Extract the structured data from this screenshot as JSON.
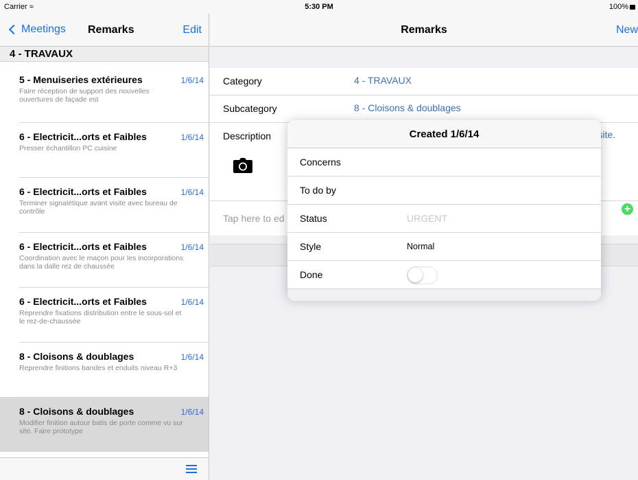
{
  "status_bar": {
    "carrier": "Carrier",
    "time": "5:30 PM",
    "battery": "100%"
  },
  "master": {
    "back_label": "Meetings",
    "title": "Remarks",
    "edit_label": "Edit",
    "section_header": "4 - TRAVAUX",
    "items": [
      {
        "title": "5 - Menuiseries extérieures",
        "date": "1/6/14",
        "desc": "Faire réception de support des nouvelles ouvertures de façade est"
      },
      {
        "title": "6 - Electricit...orts et Faibles",
        "date": "1/6/14",
        "desc": "Presser échantillon PC cuisine"
      },
      {
        "title": "6 - Electricit...orts et Faibles",
        "date": "1/6/14",
        "desc": "Terminer signalétique avant visite avec bureau de contrôle"
      },
      {
        "title": "6 - Electricit...orts et Faibles",
        "date": "1/6/14",
        "desc": "Coordination avec le maçon pour les incorporations dans la dalle  rez de chaussée"
      },
      {
        "title": "6 - Electricit...orts et Faibles",
        "date": "1/6/14",
        "desc": "Reprendre fixations  distribution entre le sous-sol et le rez-de-chaussée"
      },
      {
        "title": "8 - Cloisons & doublages",
        "date": "1/6/14",
        "desc": "Reprendre finitions bandes et enduits niveau R+3"
      },
      {
        "title": "8 - Cloisons & doublages",
        "date": "1/6/14",
        "desc": "Modifier finition autour batis de porte comme vu sur site. Faire prototype"
      }
    ]
  },
  "detail": {
    "title": "Remarks",
    "new_label": "New",
    "category_label": "Category",
    "category_value": "4 - TRAVAUX",
    "subcategory_label": "Subcategory",
    "subcategory_value": "8 - Cloisons & doublages",
    "description_label": "Description",
    "description_tail": "r site.",
    "tap_placeholder": "Tap here to ed"
  },
  "popover": {
    "header": "Created 1/6/14",
    "concerns_label": "Concerns",
    "todo_label": "To do by",
    "status_label": "Status",
    "status_placeholder": "URGENT",
    "style_label": "Style",
    "style_value": "Normal",
    "done_label": "Done",
    "done": false
  }
}
